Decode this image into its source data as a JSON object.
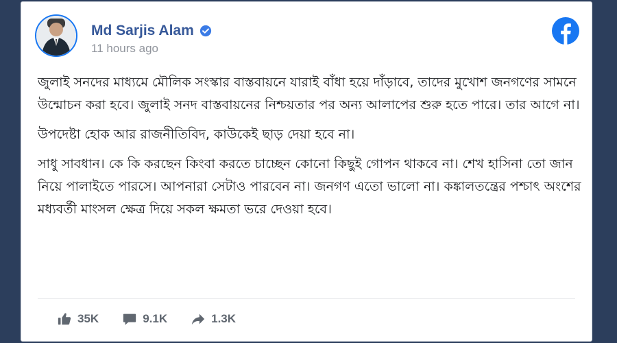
{
  "post": {
    "author": {
      "name": "Md Sarjis Alam",
      "verified": true
    },
    "timestamp": "11 hours ago",
    "paragraphs": [
      "জুলাই সনদের মাধ্যমে মৌলিক সংস্কার বাস্তবায়নে যারাই বাঁধা হয়ে দাঁড়াবে, তাদের মুখোশ জনগণের সামনে উন্মোচন করা হবে। জুলাই সনদ বাস্তবায়নের নিশ্চয়তার পর অন্য আলাপের শুরু হতে পারে। তার আগে না।",
      "উপদেষ্টা হোক আর রাজনীতিবিদ, কাউকেই ছাড় দেয়া হবে না।",
      "সাধু সাবধান। কে কি করছেন কিংবা করতে চাচ্ছেন কোনো কিছুই গোপন থাকবে না। শেখ হাসিনা তো জান নিয়ে পালাইতে পারসে। আপনারা সেটাও পারবেন না। জনগণ এতো ভালো না। কঙ্কালতন্ত্রের পশ্চাৎ অংশের মধ্যবর্তী মাংসল ক্ষেত্র দিয়ে সকল ক্ষমতা ভরে দেওয়া হবে।"
    ],
    "reactions": {
      "likes": "35K",
      "comments": "9.1K",
      "shares": "1.3K"
    }
  },
  "icons": {
    "brand": "facebook-logo-icon",
    "verified": "verified-badge-icon",
    "like": "thumbs-up-icon",
    "comment": "comment-icon",
    "share": "share-arrow-icon"
  },
  "colors": {
    "brand_blue": "#1877f2",
    "author_name": "#365899",
    "page_background": "#2c3e5c",
    "muted_text": "#90949c",
    "reaction_gray": "#606770"
  }
}
